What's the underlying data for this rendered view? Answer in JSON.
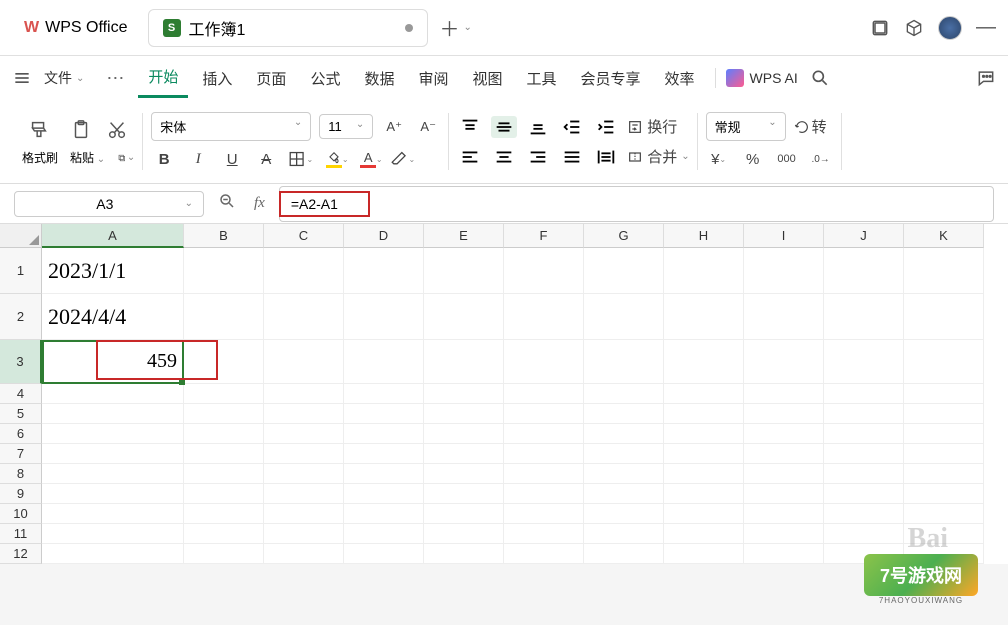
{
  "title_bar": {
    "app_name": "WPS Office",
    "doc_icon": "S",
    "doc_name": "工作簿1"
  },
  "menu": {
    "file_label": "文件",
    "items": [
      "开始",
      "插入",
      "页面",
      "公式",
      "数据",
      "审阅",
      "视图",
      "工具",
      "会员专享",
      "效率"
    ],
    "active_index": 0,
    "ai_label": "WPS AI"
  },
  "toolbar": {
    "format_brush": "格式刷",
    "paste": "粘贴",
    "font_name": "宋体",
    "font_size": "11",
    "wrap_label": "换行",
    "merge_label": "合并",
    "number_format": "常规",
    "rotate_label": "转"
  },
  "formula_bar": {
    "cell_ref": "A3",
    "formula": "=A2-A1"
  },
  "columns": [
    "A",
    "B",
    "C",
    "D",
    "E",
    "F",
    "G",
    "H",
    "I",
    "J",
    "K"
  ],
  "selected_col": "A",
  "selected_row": "3",
  "cells": {
    "A1": "2023/1/1",
    "A2": "2024/4/4",
    "A3": "459"
  },
  "watermark": {
    "brand": "7号游戏网",
    "sub": "7HAOYOUXIWANG"
  }
}
